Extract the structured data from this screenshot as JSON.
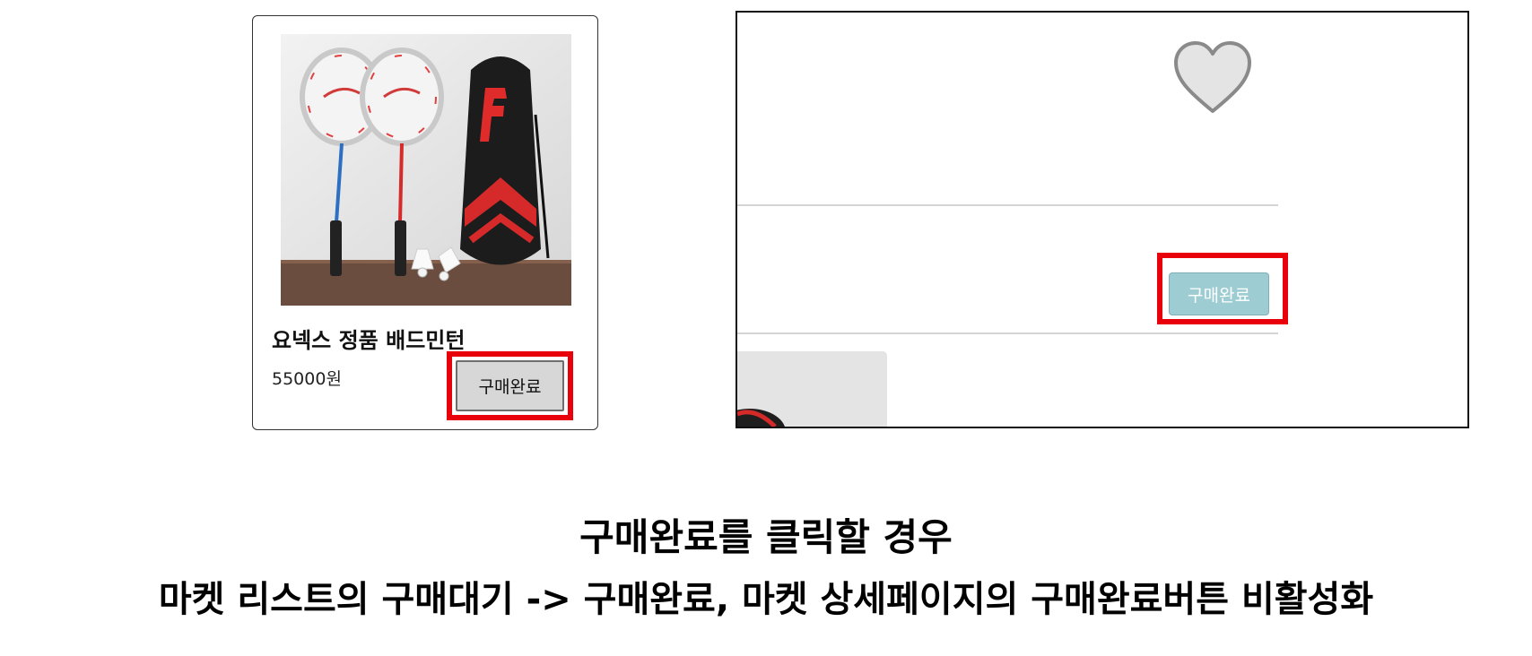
{
  "market_list": {
    "product_title": "요넥스 정품 배드민턴",
    "product_price": "55000원",
    "complete_button_label": "구매완료"
  },
  "market_detail": {
    "complete_button_label": "구매완료",
    "complete_button_state": "disabled"
  },
  "caption": {
    "line1": "구매완료를 클릭할 경우",
    "line2": "마켓 리스트의 구매대기 -> 구매완료, 마켓 상세페이지의 구매완료버튼 비활성화"
  },
  "icons": {
    "heart": "heart-icon"
  },
  "colors": {
    "highlight": "#e8000b",
    "list_button_bg": "#d7d7d7",
    "detail_button_bg": "#9dcdd3"
  }
}
